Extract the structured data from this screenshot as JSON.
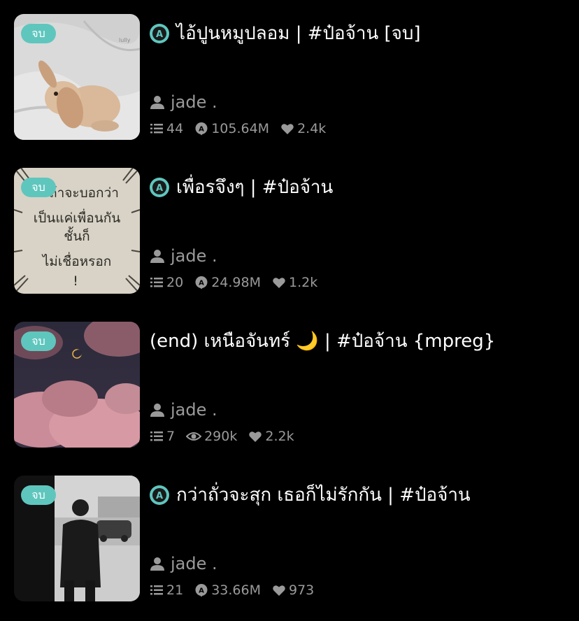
{
  "stories": [
    {
      "badge": "จบ",
      "has_a_badge": true,
      "title": "ไอ้ปูนหมูปลอม | #ป๋อจ้าน [จบ]",
      "author": "jade .",
      "chapters": "44",
      "views_icon": "a-reads-icon",
      "views": "105.64M",
      "likes": "2.4k"
    },
    {
      "badge": "จบ",
      "has_a_badge": true,
      "title": "เพื่อรจึงๆ | #ป๋อจ้าน",
      "author": "jade .",
      "chapters": "20",
      "views_icon": "a-reads-icon",
      "views": "24.98M",
      "likes": "1.2k",
      "cover_text": [
        "ถ้าจะบอกว่า",
        "เป็นแค่เพื่อนกัน",
        "ชั้นก็",
        "ไม่เชื่อหรอก",
        "!"
      ]
    },
    {
      "badge": "จบ",
      "has_a_badge": false,
      "title": "(end) เหนือจันทร์ 🌙 | #ป๋อจ้าน {mpreg}",
      "author": "jade .",
      "chapters": "7",
      "views_icon": "eye-icon",
      "views": "290k",
      "likes": "2.2k"
    },
    {
      "badge": "จบ",
      "has_a_badge": true,
      "title": "กว่าถั่วจะสุก เธอก็ไม่รักกัน | #ป๋อจ้าน",
      "author": "jade .",
      "chapters": "21",
      "views_icon": "a-reads-icon",
      "views": "33.66M",
      "likes": "973"
    }
  ],
  "colors": {
    "background": "#000000",
    "badge": "#5fc6be",
    "meta_text": "#9a9a9a",
    "title_text": "#ffffff"
  }
}
